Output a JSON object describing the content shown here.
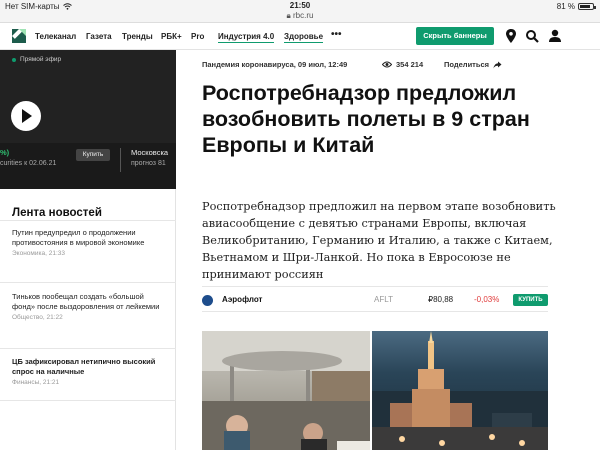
{
  "statusbar": {
    "carrier": "Нет SIM-карты",
    "time": "21:50",
    "battery": "81 %",
    "battery_level": 0.81
  },
  "urlbar": {
    "url": "rbc.ru"
  },
  "nav": {
    "items": [
      "Телеканал",
      "Газета",
      "Тренды",
      "РБК+",
      "Pro",
      "Индустрия 4.0",
      "Здоровье"
    ],
    "more": "•••",
    "subscribe_label": "Скрыть баннеры",
    "accent": "#0f9b6e"
  },
  "live": {
    "label": "Прямой эфир"
  },
  "quote": {
    "pct": "%)",
    "sub": "curities к 02.06.21",
    "buy": "Купить",
    "name": "Московска",
    "name2": "прогноз 81"
  },
  "feed": {
    "title": "Лента новостей",
    "items": [
      {
        "title": "Путин предупредил о продолжении противостояния в мировой экономике",
        "meta": "Экономика, 21:33",
        "bold": false
      },
      {
        "title": "Тиньков пообещал создать «большой фонд» после выздоровления от лейкемии",
        "meta": "Общество, 21:22",
        "bold": false
      },
      {
        "title": "ЦБ зафиксировал нетипично высокий спрос на наличные",
        "meta": "Финансы, 21:21",
        "bold": true
      }
    ]
  },
  "article": {
    "meta": "Пандемия коронавируса, 09 июл, 12:49",
    "views": "354 214",
    "share": "Поделиться",
    "headline": "Роспотребнадзор предложил возобновить полеты в 9 стран Европы и Китай",
    "lead": "Роспотребнадзор предложил на первом этапе возобновить авиасообщение с девятью странами Европы, включая Великобританию, Германию и Италию, а также с Китаем, Вьетнамом и Шри-Ланкой. Но пока в Евросоюзе не принимают россиян"
  },
  "ticker": {
    "name": "Аэрофлот",
    "code": "AFLT",
    "price": "₽80,88",
    "change": "-0,03%",
    "buy": "КУПИТЬ",
    "change_color": "#e03b3b"
  }
}
